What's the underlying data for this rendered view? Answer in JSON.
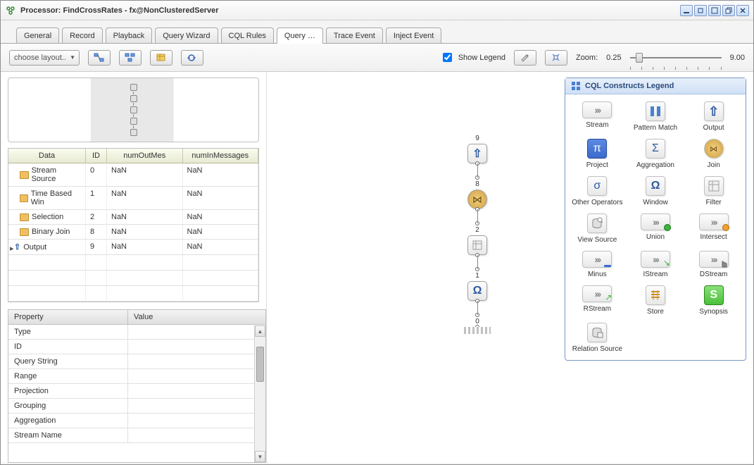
{
  "window": {
    "title": "Processor: FindCrossRates - fx@NonClusteredServer"
  },
  "tabs": [
    "General",
    "Record",
    "Playback",
    "Query Wizard",
    "CQL Rules",
    "Query …",
    "Trace Event",
    "Inject Event"
  ],
  "active_tab_index": 5,
  "toolbar": {
    "layout_label": "choose layout..",
    "show_legend_label": "Show Legend",
    "show_legend_checked": true,
    "zoom_label": "Zoom:",
    "zoom_min": "0.25",
    "zoom_max": "9.00"
  },
  "data_table": {
    "headers": [
      "Data",
      "ID",
      "numOutMes",
      "numInMessages"
    ],
    "rows": [
      {
        "icon": "folder",
        "data": "Stream Source",
        "id": "0",
        "out": "NaN",
        "in": "NaN"
      },
      {
        "icon": "folder",
        "data": "Time Based Win",
        "id": "1",
        "out": "NaN",
        "in": "NaN"
      },
      {
        "icon": "folder",
        "data": "Selection",
        "id": "2",
        "out": "NaN",
        "in": "NaN"
      },
      {
        "icon": "folder",
        "data": "Binary Join",
        "id": "8",
        "out": "NaN",
        "in": "NaN"
      },
      {
        "icon": "output",
        "data": "Output",
        "id": "9",
        "out": "NaN",
        "in": "NaN"
      }
    ]
  },
  "prop_table": {
    "headers": [
      "Property",
      "Value"
    ],
    "rows": [
      "Type",
      "ID",
      "Query String",
      "Range",
      "Projection",
      "Grouping",
      "Aggregation",
      "Stream Name"
    ]
  },
  "flow_nodes": [
    {
      "label": "9",
      "kind": "output"
    },
    {
      "label": "8",
      "kind": "join"
    },
    {
      "label": "2",
      "kind": "filter"
    },
    {
      "label": "1",
      "kind": "window"
    },
    {
      "label": "0",
      "kind": "stream"
    }
  ],
  "legend": {
    "title": "CQL Constructs Legend",
    "items": [
      {
        "label": "Stream",
        "kind": "chevrons"
      },
      {
        "label": "Pattern Match",
        "kind": "pattern"
      },
      {
        "label": "Output",
        "kind": "output"
      },
      {
        "label": "Project",
        "kind": "pi"
      },
      {
        "label": "Aggregation",
        "kind": "sigma"
      },
      {
        "label": "Join",
        "kind": "join"
      },
      {
        "label": "Other Operators",
        "kind": "sigma2"
      },
      {
        "label": "Window",
        "kind": "omega"
      },
      {
        "label": "Filter",
        "kind": "filter"
      },
      {
        "label": "View Source",
        "kind": "db"
      },
      {
        "label": "Union",
        "kind": "chev-green"
      },
      {
        "label": "Intersect",
        "kind": "chev-orange"
      },
      {
        "label": "Minus",
        "kind": "chev-minus"
      },
      {
        "label": "IStream",
        "kind": "chev-in"
      },
      {
        "label": "DStream",
        "kind": "chev-d"
      },
      {
        "label": "RStream",
        "kind": "chev-r"
      },
      {
        "label": "Store",
        "kind": "store"
      },
      {
        "label": "Synopsis",
        "kind": "synopsis"
      },
      {
        "label": "Relation Source",
        "kind": "db2"
      }
    ]
  }
}
